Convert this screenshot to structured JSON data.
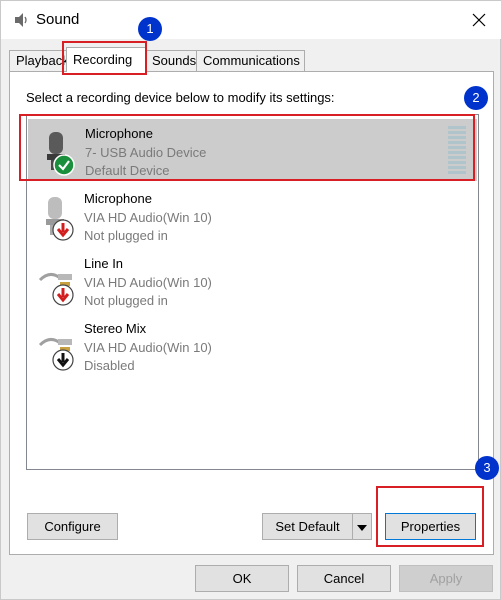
{
  "window": {
    "title": "Sound"
  },
  "tabs": [
    {
      "label": "Playback",
      "active": false
    },
    {
      "label": "Recording",
      "active": true
    },
    {
      "label": "Sounds",
      "active": false
    },
    {
      "label": "Communications",
      "active": false
    }
  ],
  "panel": {
    "instruction": "Select a recording device below to modify its settings:"
  },
  "devices": [
    {
      "name": "Microphone",
      "line1": "7- USB Audio Device",
      "line2": "Default Device",
      "icon": "microphone-icon",
      "status_icon": "default-check-icon",
      "selected": true
    },
    {
      "name": "Microphone",
      "line1": "VIA HD Audio(Win 10)",
      "line2": "Not plugged in",
      "icon": "microphone-icon",
      "status_icon": "unplugged-red-arrow-icon",
      "selected": false
    },
    {
      "name": "Line In",
      "line1": "VIA HD Audio(Win 10)",
      "line2": "Not plugged in",
      "icon": "line-in-cable-icon",
      "status_icon": "unplugged-red-arrow-icon",
      "selected": false
    },
    {
      "name": "Stereo Mix",
      "line1": "VIA HD Audio(Win 10)",
      "line2": "Disabled",
      "icon": "stereo-mix-cable-icon",
      "status_icon": "disabled-down-arrow-icon",
      "selected": false
    }
  ],
  "buttons": {
    "configure": "Configure",
    "set_default": "Set Default",
    "properties": "Properties",
    "ok": "OK",
    "cancel": "Cancel",
    "apply": "Apply"
  },
  "annotations": [
    {
      "number": "1",
      "target": "recording-tab"
    },
    {
      "number": "2",
      "target": "device-microphone-usb"
    },
    {
      "number": "3",
      "target": "properties-button"
    }
  ],
  "colors": {
    "annotation_border": "#d91f26",
    "annotation_circle": "#0033cc",
    "selected_row": "#cccccc",
    "check_green": "#1a8f3c",
    "unplugged_red": "#d11f1f"
  }
}
